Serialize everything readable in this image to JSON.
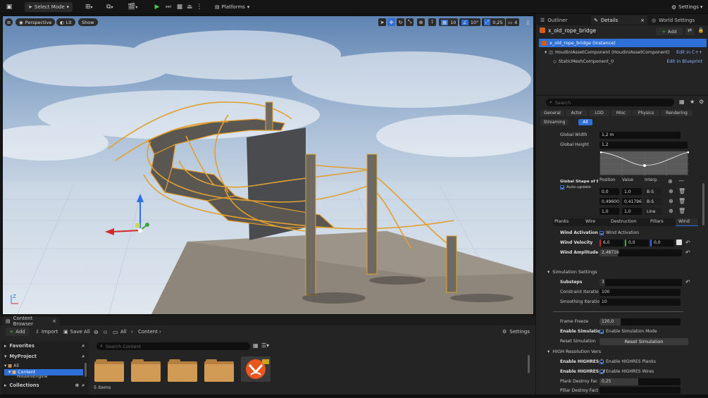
{
  "toolbar": {
    "select_mode": "Select Mode",
    "platforms": "Platforms",
    "settings": "Settings"
  },
  "viewport": {
    "perspective": "Perspective",
    "lit": "Lit",
    "show": "Show",
    "grid_size": "10",
    "angle": "10°",
    "scale": "0,25",
    "camera_speed": "4"
  },
  "outliner_tabs": {
    "outliner": "Outliner",
    "details": "Details",
    "world_settings": "World Settings"
  },
  "details": {
    "actor_name": "x_old_rope_bridge",
    "add": "Add",
    "instance": "x_old_rope_bridge (Instance)",
    "component1": "HoudiniAssetComponent (HoudiniAssetComponent)",
    "component1_link": "Edit in C++",
    "component2": "StaticMeshComponent_0",
    "component2_link": "Edit in Blueprint",
    "search_placeholder": "Search",
    "filters": [
      "General",
      "Actor",
      "LOD",
      "Misc",
      "Physics",
      "Rendering",
      "Streaming",
      "All"
    ],
    "global_width_label": "Global Width",
    "global_width": "1,2 m",
    "global_height_label": "Global Height",
    "global_height": "1,2",
    "shape_label": "Global Shape of Br",
    "auto_update": "Auto-update",
    "curve_head_position": "Position",
    "curve_head_value": "Value",
    "curve_head_interp": "Interp.",
    "curve_rows": [
      {
        "pos": "0,0",
        "val": "1,0",
        "interp": "B-S"
      },
      {
        "pos": "0,49600",
        "val": "0,41796",
        "interp": "B-S"
      },
      {
        "pos": "1,0",
        "val": "1,0",
        "interp": "Line"
      }
    ],
    "subtabs": [
      "Planks",
      "Wire",
      "Destruction",
      "Pillars",
      "Wind"
    ],
    "wind_activation_label": "Wind Activation",
    "wind_activation": "Wind Activation",
    "wind_velocity_label": "Wind Velocity",
    "wind_velocity": [
      "6,0",
      "0,0",
      "0,0"
    ],
    "wind_amplitude_label": "Wind Amplitude",
    "wind_amplitude": "2,48716",
    "sim_settings": "Simulation Settings",
    "substeps_label": "Substeps",
    "substeps": "3",
    "constraint_label": "Constraint Iteratio",
    "constraint": "100",
    "smoothing_label": "Smoothing Iteratio",
    "smoothing": "10",
    "frame_freeze_label": "Frame Freeze",
    "frame_freeze": "120,0",
    "enable_sim_label": "Enable Simulation",
    "enable_sim": "Enable Simulation Mode",
    "reset_sim_label": "Reset Simulation",
    "reset_sim": "Reset Simulation",
    "high_res": "HIGH Resolution Vers",
    "enable_highres_p_label": "Enable HIGHRES P",
    "enable_highres_p": "Enable HIGHRES Planks",
    "enable_highres_w_label": "Enable HIGHRES W",
    "enable_highres_w": "Enable HIGHRES Wires",
    "plank_destroy_label": "Plank Destroy Fac",
    "plank_destroy": "0,25",
    "pillar_destroy_label": "Pillar Destroy Fact"
  },
  "content_browser": {
    "tab": "Content Browser",
    "add": "Add",
    "import": "Import",
    "save_all": "Save All",
    "crumb_all": "All",
    "crumb_content": "Content",
    "settings": "Settings",
    "favorites": "Favorites",
    "my_project": "MyProject",
    "tree": [
      "All",
      "Content",
      "HoudiniEngine"
    ],
    "search_placeholder": "Search Content",
    "items_count": "5 items",
    "collections": "Collections"
  },
  "colors": {
    "accent": "#2f6fd8",
    "rope": "#e0a030",
    "folder": "#c8914d"
  }
}
